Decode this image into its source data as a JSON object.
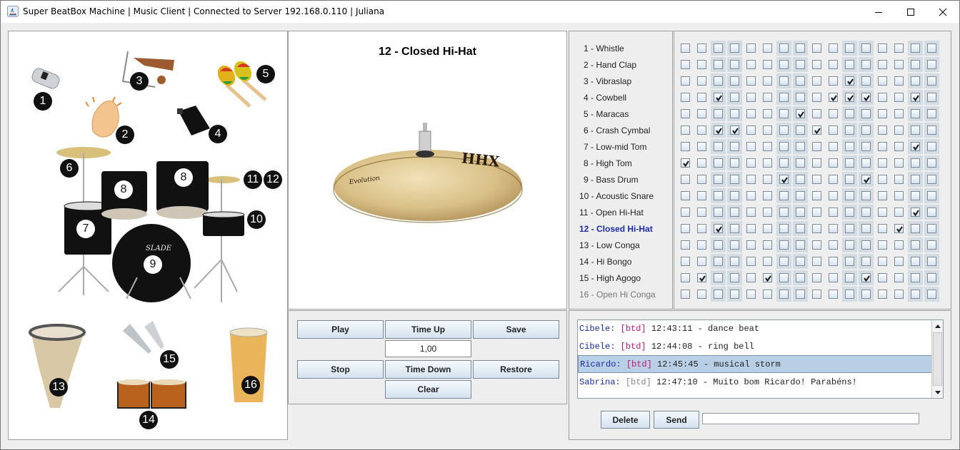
{
  "window": {
    "title": "Super BeatBox Machine | Music Client | Connected to Server 192.168.0.110 | Juliana",
    "controls": [
      "minimize",
      "maximize",
      "close"
    ]
  },
  "instrument_map": {
    "badges": [
      {
        "number": "1",
        "instrument": "Whistle"
      },
      {
        "number": "2",
        "instrument": "Hand Clap"
      },
      {
        "number": "3",
        "instrument": "Vibraslap"
      },
      {
        "number": "4",
        "instrument": "Cowbell"
      },
      {
        "number": "5",
        "instrument": "Maracas"
      },
      {
        "number": "6",
        "instrument": "Crash Cymbal"
      },
      {
        "number": "7",
        "instrument": "Low-mid Tom"
      },
      {
        "number": "8",
        "instrument": "High Tom"
      },
      {
        "number": "8",
        "instrument": "High Tom"
      },
      {
        "number": "9",
        "instrument": "Bass Drum"
      },
      {
        "number": "10",
        "instrument": "Acoustic Snare"
      },
      {
        "number": "11",
        "instrument": "Open Hi-Hat"
      },
      {
        "number": "12",
        "instrument": "Closed Hi-Hat"
      },
      {
        "number": "13",
        "instrument": "Low Conga"
      },
      {
        "number": "14",
        "instrument": "Hi Bongo"
      },
      {
        "number": "15",
        "instrument": "High Agogo"
      },
      {
        "number": "16",
        "instrument": "Open Hi Conga"
      }
    ],
    "drum_logo": "SLADE"
  },
  "preview": {
    "title": "12 - Closed Hi-Hat",
    "cymbal_brand": "HHX",
    "cymbal_series": "Evolution"
  },
  "controls": {
    "play": "Play",
    "time_up": "Time Up",
    "save": "Save",
    "tempo_value": "1,00",
    "stop": "Stop",
    "time_down": "Time Down",
    "restore": "Restore",
    "clear": "Clear"
  },
  "instruments": [
    {
      "label": "1 - Whistle",
      "state": "normal"
    },
    {
      "label": "2 - Hand Clap",
      "state": "normal"
    },
    {
      "label": "3 - Vibraslap",
      "state": "normal"
    },
    {
      "label": "4 - Cowbell",
      "state": "normal"
    },
    {
      "label": "5 - Maracas",
      "state": "normal"
    },
    {
      "label": "6 - Crash Cymbal",
      "state": "normal"
    },
    {
      "label": "7 - Low-mid Tom",
      "state": "normal"
    },
    {
      "label": "8 - High Tom",
      "state": "normal"
    },
    {
      "label": "9 - Bass Drum",
      "state": "normal"
    },
    {
      "label": "10 - Acoustic Snare",
      "state": "normal"
    },
    {
      "label": "11 - Open Hi-Hat",
      "state": "normal"
    },
    {
      "label": "12 - Closed Hi-Hat",
      "state": "selected"
    },
    {
      "label": "13 - Low Conga",
      "state": "normal"
    },
    {
      "label": "14 - Hi Bongo",
      "state": "normal"
    },
    {
      "label": "15 - High Agogo",
      "state": "normal"
    },
    {
      "label": "16 - Open Hi Conga",
      "state": "dim"
    }
  ],
  "beat_grid": {
    "steps": 16,
    "shaded_steps": [
      3,
      4,
      7,
      8,
      11,
      12,
      15,
      16
    ],
    "checked": [
      [],
      [],
      [
        11
      ],
      [
        3,
        10,
        11,
        12,
        15
      ],
      [
        8
      ],
      [
        3,
        4,
        9
      ],
      [
        15
      ],
      [
        1
      ],
      [
        7,
        12
      ],
      [],
      [
        15
      ],
      [
        3,
        14
      ],
      [],
      [],
      [
        2,
        6,
        12
      ],
      []
    ]
  },
  "chat": {
    "messages": [
      {
        "user": "Cibele:",
        "tag": "[btd]",
        "tag_style": "pink",
        "text": "12:43:11 - dance beat",
        "selected": false
      },
      {
        "user": "Cibele:",
        "tag": "[btd]",
        "tag_style": "pink",
        "text": "12:44:08 - ring bell",
        "selected": false
      },
      {
        "user": "Ricardo:",
        "tag": "[btd]",
        "tag_style": "pink",
        "text": "12:45:45 - musical storm",
        "selected": true
      },
      {
        "user": "Sabrina:",
        "tag": "[btd]",
        "tag_style": "grey",
        "text": "12:47:10 - Muito bom Ricardo! Parabéns!",
        "selected": false
      }
    ],
    "delete": "Delete",
    "send": "Send",
    "input_value": ""
  },
  "colors": {
    "selected_instrument": "#1c2aa8",
    "chat_user": "#1c2aa8",
    "chat_tag": "#c2187a",
    "selection_bg": "#b8cfe5",
    "grid_shade": "#d3dbe3"
  }
}
